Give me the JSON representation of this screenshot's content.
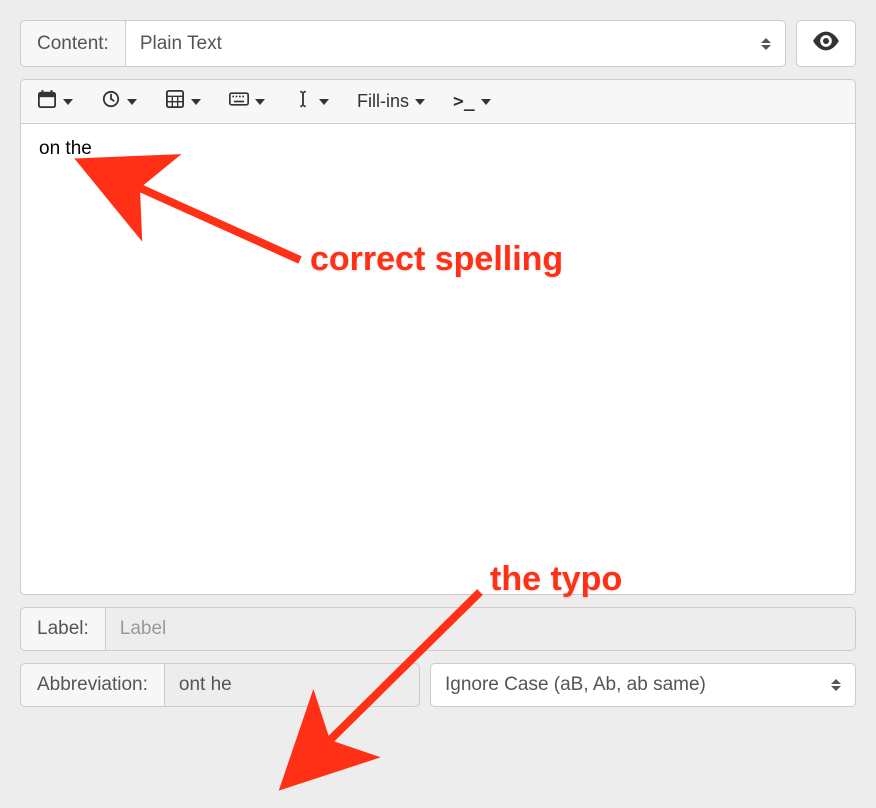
{
  "header": {
    "content_label": "Content:",
    "content_type": "Plain Text"
  },
  "toolbar": {
    "fillins_label": "Fill-ins"
  },
  "editor": {
    "content": "on the"
  },
  "label_row": {
    "label": "Label:",
    "placeholder": "Label"
  },
  "abbrev_row": {
    "label": "Abbreviation:",
    "value": "ont he",
    "case_option": "Ignore Case (aB, Ab, ab same)"
  },
  "annotations": {
    "correct": "correct spelling",
    "typo": "the typo"
  }
}
